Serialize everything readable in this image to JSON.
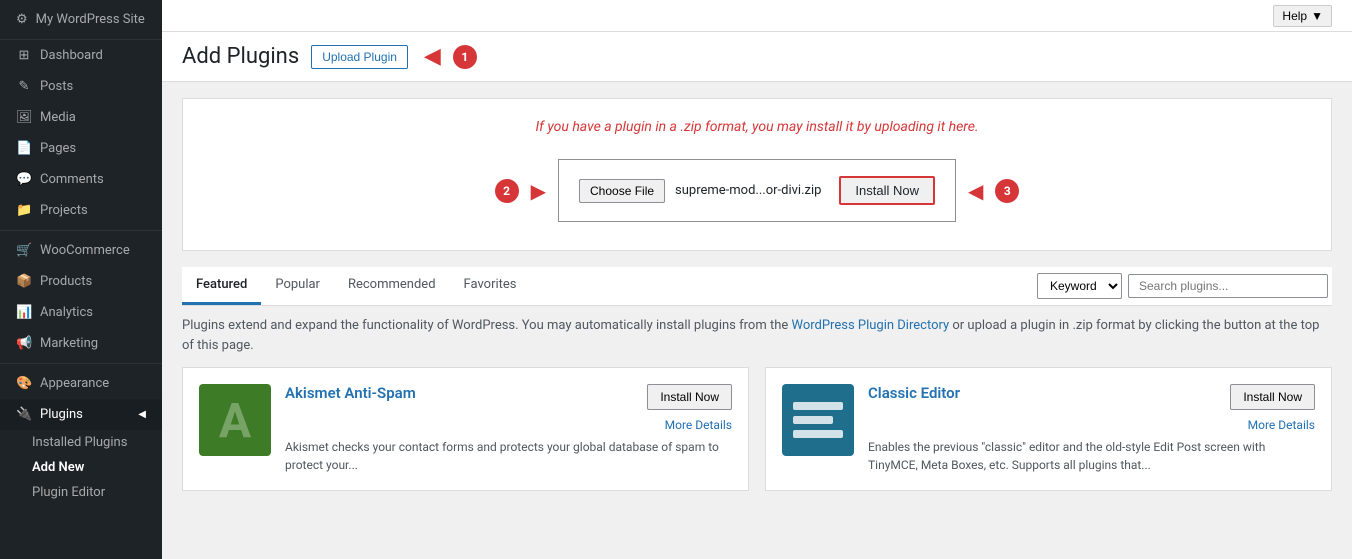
{
  "sidebar": {
    "items": [
      {
        "id": "dashboard",
        "label": "Dashboard",
        "icon": "⊞"
      },
      {
        "id": "posts",
        "label": "Posts",
        "icon": "✎"
      },
      {
        "id": "media",
        "label": "Media",
        "icon": "🖼"
      },
      {
        "id": "pages",
        "label": "Pages",
        "icon": "📄"
      },
      {
        "id": "comments",
        "label": "Comments",
        "icon": "💬"
      },
      {
        "id": "projects",
        "label": "Projects",
        "icon": "📁"
      },
      {
        "id": "woocommerce",
        "label": "WooCommerce",
        "icon": "🛒"
      },
      {
        "id": "products",
        "label": "Products",
        "icon": "📦"
      },
      {
        "id": "analytics",
        "label": "Analytics",
        "icon": "📊"
      },
      {
        "id": "marketing",
        "label": "Marketing",
        "icon": "📢"
      },
      {
        "id": "appearance",
        "label": "Appearance",
        "icon": "🎨"
      },
      {
        "id": "plugins",
        "label": "Plugins",
        "icon": "🔌"
      }
    ],
    "plugins_sub": [
      {
        "label": "Installed Plugins",
        "id": "installed-plugins"
      },
      {
        "label": "Add New",
        "id": "add-new",
        "active": true
      },
      {
        "label": "Plugin Editor",
        "id": "plugin-editor"
      }
    ]
  },
  "topbar": {
    "help_label": "Help",
    "help_arrow": "▼"
  },
  "header": {
    "title": "Add Plugins",
    "upload_btn": "Upload Plugin",
    "step1": "1"
  },
  "upload_section": {
    "instruction": "If you have a plugin in a .zip format, you may install it by uploading it here.",
    "step2": "2",
    "choose_file_label": "Choose File",
    "file_name": "supreme-mod...or-divi.zip",
    "install_now_label": "Install Now",
    "step3": "3"
  },
  "tabs": {
    "items": [
      {
        "label": "Featured",
        "active": true
      },
      {
        "label": "Popular",
        "active": false
      },
      {
        "label": "Recommended",
        "active": false
      },
      {
        "label": "Favorites",
        "active": false
      }
    ],
    "search": {
      "keyword_label": "Keyword",
      "placeholder": "Search plugins..."
    }
  },
  "description": {
    "text_before_link": "Plugins extend and expand the functionality of WordPress. You may automatically install plugins from the ",
    "link_text": "WordPress Plugin Directory",
    "text_after_link": " or upload a plugin in .zip format by clicking the button at the top of this page."
  },
  "plugins": [
    {
      "id": "akismet",
      "name": "Akismet Anti-Spam",
      "description": "Akismet checks your contact forms and protects your global database of spam to protect your...",
      "install_label": "Install Now",
      "more_details": "More Details",
      "type": "akismet"
    },
    {
      "id": "classic-editor",
      "name": "Classic Editor",
      "description": "Enables the previous \"classic\" editor and the old-style Edit Post screen with TinyMCE, Meta Boxes, etc. Supports all plugins that...",
      "install_label": "Install Now",
      "more_details": "More Details",
      "type": "classic"
    }
  ]
}
